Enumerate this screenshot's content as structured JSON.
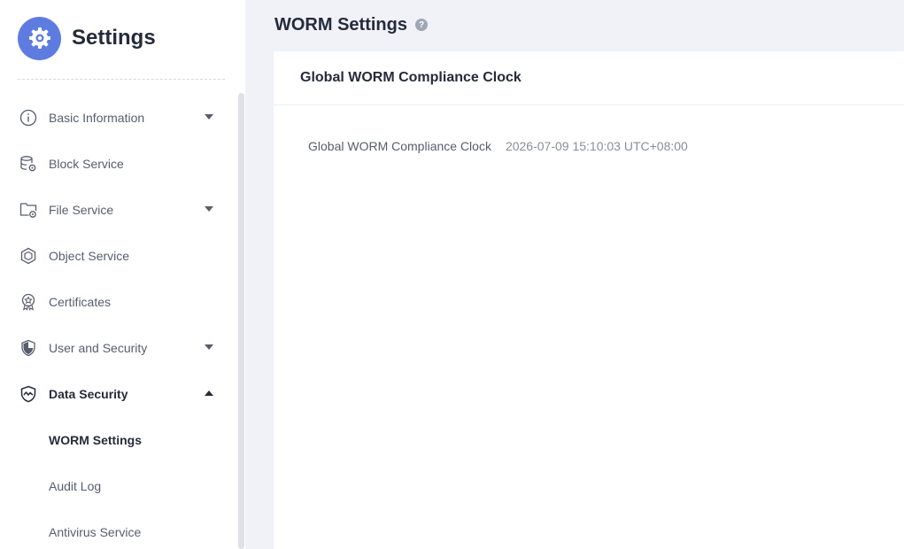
{
  "sidebar": {
    "title": "Settings",
    "items": [
      {
        "label": "Basic Information",
        "icon": "info-icon",
        "expandable": true,
        "expanded": false
      },
      {
        "label": "Block Service",
        "icon": "database-gear-icon",
        "expandable": false
      },
      {
        "label": "File Service",
        "icon": "folder-gear-icon",
        "expandable": true,
        "expanded": false
      },
      {
        "label": "Object Service",
        "icon": "cube-icon",
        "expandable": false
      },
      {
        "label": "Certificates",
        "icon": "certificate-badge-icon",
        "expandable": false
      },
      {
        "label": "User and Security",
        "icon": "shield-icon",
        "expandable": true,
        "expanded": false
      },
      {
        "label": "Data Security",
        "icon": "shield-pulse-icon",
        "expandable": true,
        "expanded": true
      }
    ],
    "sub_items": [
      {
        "label": "WORM Settings",
        "active": true
      },
      {
        "label": "Audit Log",
        "active": false
      },
      {
        "label": "Antivirus Service",
        "active": false
      }
    ]
  },
  "main": {
    "page_title": "WORM Settings",
    "help_glyph": "?",
    "panel": {
      "title": "Global WORM Compliance Clock",
      "field_label": "Global WORM Compliance Clock",
      "field_value": "2026-07-09 15:10:03 UTC+08:00"
    }
  },
  "colors": {
    "accent": "#5e7ce0",
    "page_bg": "#f0f2f8",
    "text_primary": "#252b3a",
    "text_secondary": "#575d6c",
    "text_muted": "#8a8e99"
  }
}
